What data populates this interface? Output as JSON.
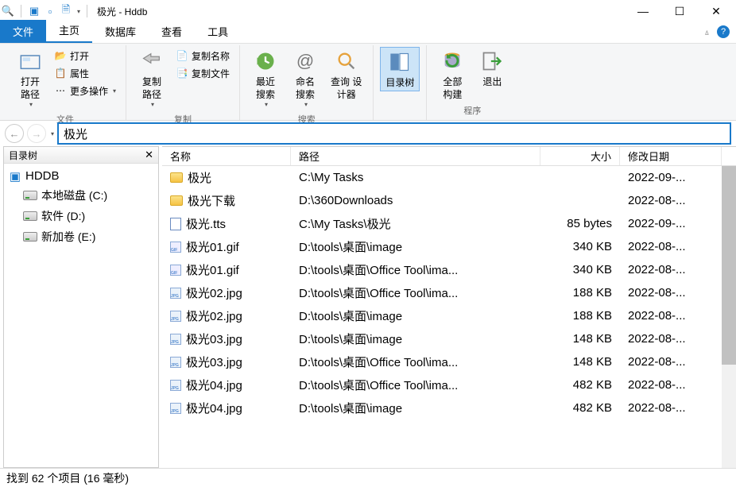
{
  "window": {
    "title": "极光 - Hddb"
  },
  "ribbon": {
    "tabs": {
      "file": "文件",
      "home": "主页",
      "database": "数据库",
      "view": "查看",
      "tools": "工具"
    },
    "group_file": {
      "label": "文件",
      "open_path": "打开路径",
      "open": "打开",
      "properties": "属性",
      "more": "更多操作"
    },
    "group_copy": {
      "label": "复制",
      "copy_path": "复制路径",
      "copy_name": "复制名称",
      "copy_file": "复制文件"
    },
    "group_search": {
      "label": "搜索",
      "recent": "最近搜索",
      "named": "命名搜索",
      "query_design": "查询 设计器"
    },
    "dir_tree": "目录树",
    "rebuild_all": "全部构建",
    "exit": "退出",
    "group_program": "程序"
  },
  "search": {
    "value": "极光"
  },
  "sidebar": {
    "title": "目录树",
    "root": "HDDB",
    "items": [
      "本地磁盘 (C:)",
      "软件 (D:)",
      "新加卷 (E:)"
    ]
  },
  "columns": {
    "name": "名称",
    "path": "路径",
    "size": "大小",
    "date": "修改日期"
  },
  "rows": [
    {
      "icon": "folder",
      "name": "极光",
      "path": "C:\\My Tasks",
      "size": "",
      "date": "2022-09-..."
    },
    {
      "icon": "folder",
      "name": "极光下载",
      "path": "D:\\360Downloads",
      "size": "",
      "date": "2022-08-..."
    },
    {
      "icon": "tts",
      "name": "极光.tts",
      "path": "C:\\My Tasks\\极光",
      "size": "85 bytes",
      "date": "2022-09-..."
    },
    {
      "icon": "gif",
      "name": "极光01.gif",
      "path": "D:\\tools\\桌面\\image",
      "size": "340 KB",
      "date": "2022-08-..."
    },
    {
      "icon": "gif",
      "name": "极光01.gif",
      "path": "D:\\tools\\桌面\\Office Tool\\ima...",
      "size": "340 KB",
      "date": "2022-08-..."
    },
    {
      "icon": "jpg",
      "name": "极光02.jpg",
      "path": "D:\\tools\\桌面\\Office Tool\\ima...",
      "size": "188 KB",
      "date": "2022-08-..."
    },
    {
      "icon": "jpg",
      "name": "极光02.jpg",
      "path": "D:\\tools\\桌面\\image",
      "size": "188 KB",
      "date": "2022-08-..."
    },
    {
      "icon": "jpg",
      "name": "极光03.jpg",
      "path": "D:\\tools\\桌面\\image",
      "size": "148 KB",
      "date": "2022-08-..."
    },
    {
      "icon": "jpg",
      "name": "极光03.jpg",
      "path": "D:\\tools\\桌面\\Office Tool\\ima...",
      "size": "148 KB",
      "date": "2022-08-..."
    },
    {
      "icon": "jpg",
      "name": "极光04.jpg",
      "path": "D:\\tools\\桌面\\Office Tool\\ima...",
      "size": "482 KB",
      "date": "2022-08-..."
    },
    {
      "icon": "jpg",
      "name": "极光04.jpg",
      "path": "D:\\tools\\桌面\\image",
      "size": "482 KB",
      "date": "2022-08-..."
    }
  ],
  "statusbar": "找到 62 个项目 (16 毫秒)"
}
